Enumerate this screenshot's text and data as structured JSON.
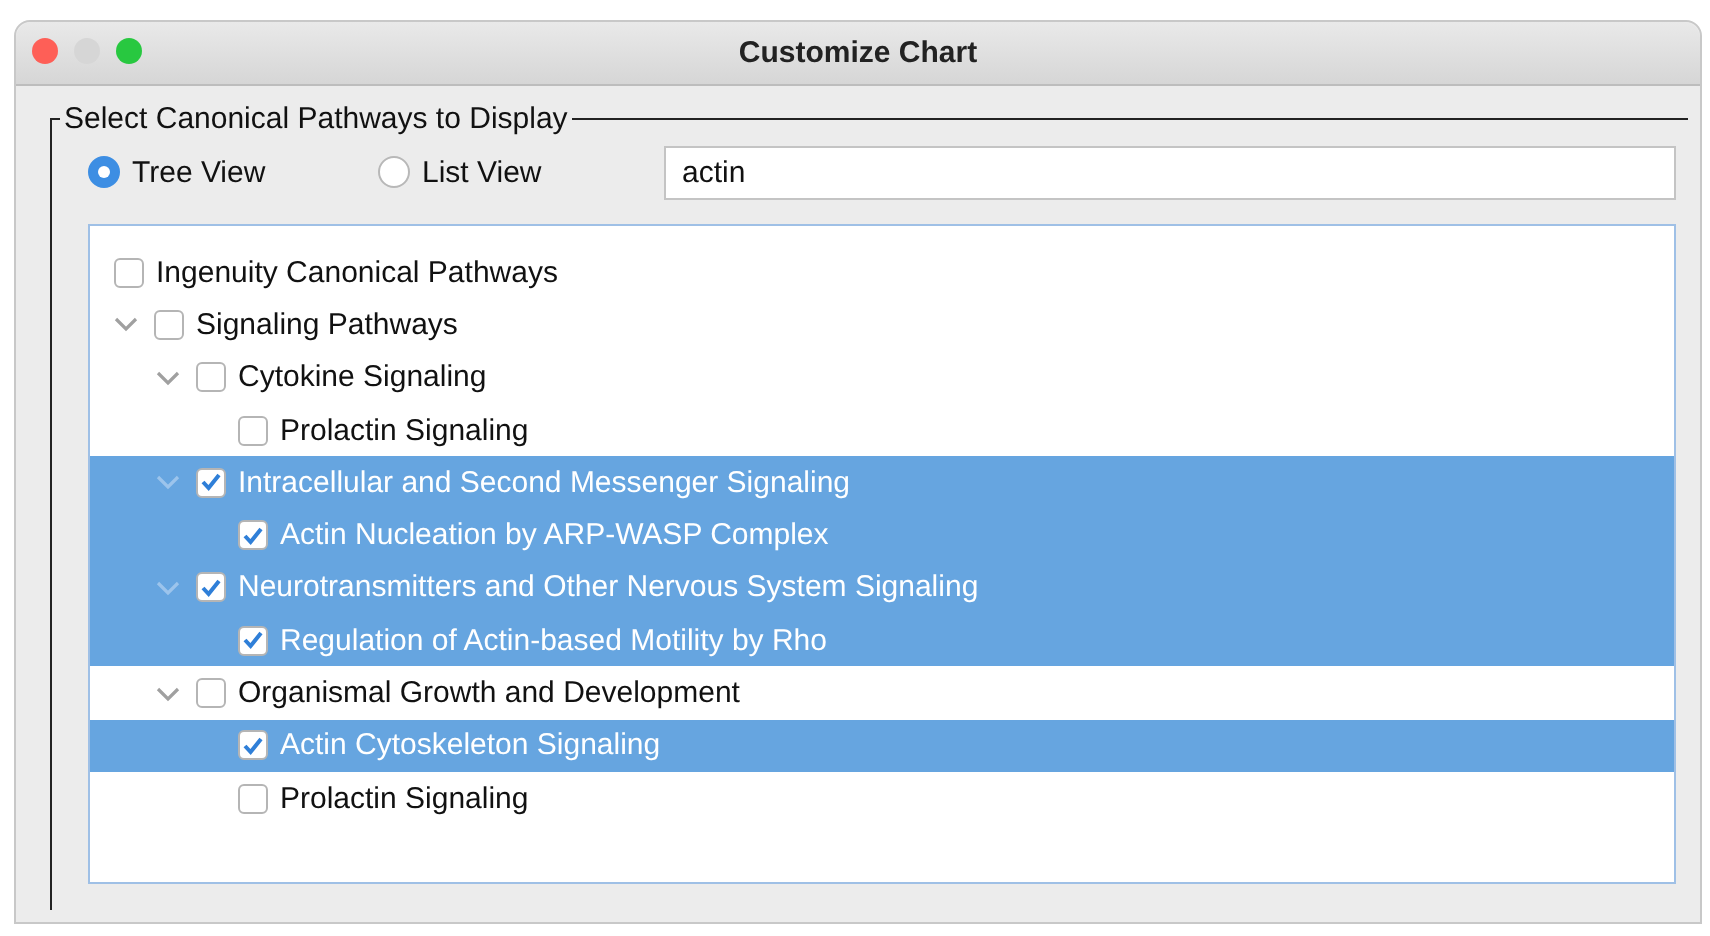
{
  "window": {
    "title": "Customize Chart"
  },
  "group": {
    "legend": "Select Canonical Pathways to Display"
  },
  "view_options": [
    {
      "label": "Tree View",
      "selected": true
    },
    {
      "label": "List View",
      "selected": false
    }
  ],
  "search": {
    "value": "actin"
  },
  "tree": [
    {
      "label": "Ingenuity Canonical Pathways",
      "checked": false,
      "selected": false,
      "children": [
        {
          "label": "Signaling Pathways",
          "checked": false,
          "selected": false,
          "expanded": true,
          "children": [
            {
              "label": "Cytokine Signaling",
              "checked": false,
              "selected": false,
              "expanded": true,
              "children": [
                {
                  "label": "Prolactin Signaling",
                  "checked": false,
                  "selected": false
                }
              ]
            },
            {
              "label": "Intracellular and Second Messenger Signaling",
              "checked": true,
              "selected": true,
              "expanded": true,
              "children": [
                {
                  "label": "Actin Nucleation by ARP-WASP Complex",
                  "checked": true,
                  "selected": true
                }
              ]
            },
            {
              "label": "Neurotransmitters and Other Nervous System Signaling",
              "checked": true,
              "selected": true,
              "expanded": true,
              "children": [
                {
                  "label": "Regulation of Actin-based Motility by Rho",
                  "checked": true,
                  "selected": true
                }
              ]
            },
            {
              "label": "Organismal Growth and Development",
              "checked": false,
              "selected": false,
              "expanded": true,
              "children": [
                {
                  "label": "Actin Cytoskeleton Signaling",
                  "checked": true,
                  "selected": true
                },
                {
                  "label": "Prolactin Signaling",
                  "checked": false,
                  "selected": false
                }
              ]
            }
          ]
        }
      ]
    }
  ]
}
